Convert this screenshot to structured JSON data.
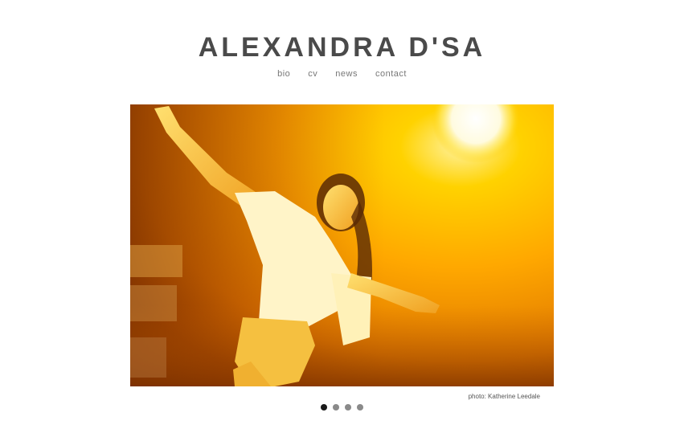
{
  "header": {
    "site_title": "ALEXANDRA D'SA"
  },
  "nav": {
    "items": [
      {
        "label": "bio"
      },
      {
        "label": "cv"
      },
      {
        "label": "news"
      },
      {
        "label": "contact"
      }
    ]
  },
  "slideshow": {
    "image_icon": "dancer-stage-photo",
    "caption": "photo: Katherine Leedale",
    "slide_count": 4,
    "active_slide": 1
  },
  "colors": {
    "title": "#4a4a4a",
    "nav_text": "#777777",
    "dot_active": "#1a1a1a",
    "dot_inactive": "#8a8a8a",
    "stage_light": "#ffb000"
  }
}
